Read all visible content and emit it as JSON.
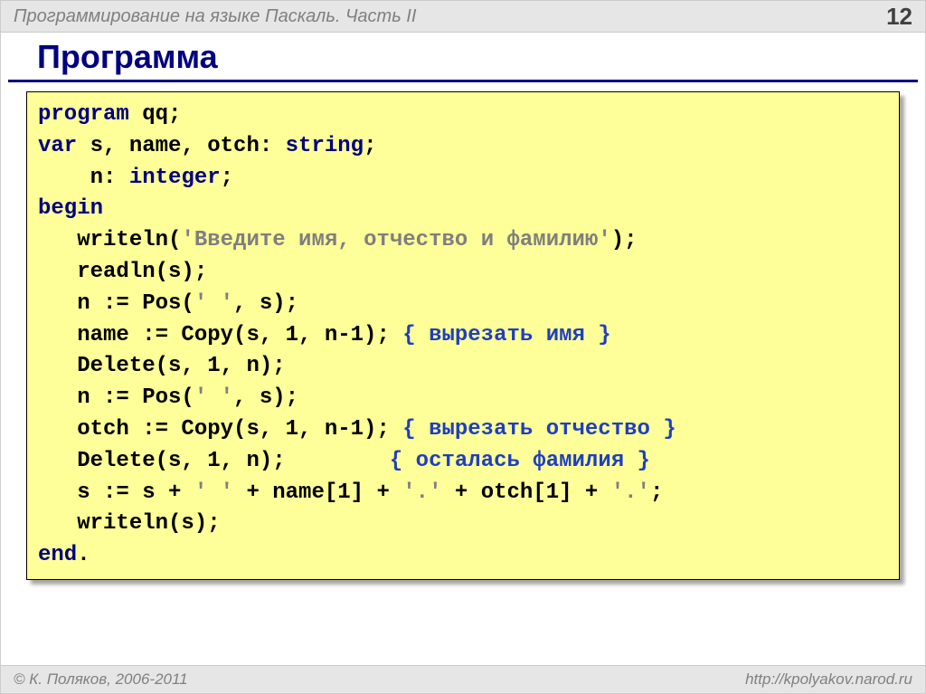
{
  "header": {
    "title": "Программирование на языке Паскаль. Часть II",
    "page": "12"
  },
  "title": "Программа",
  "code": {
    "l1": {
      "kw": "program",
      "rest": " qq;"
    },
    "l2": {
      "kw": "var",
      "rest": " s, name, otch: ",
      "type": "string",
      "end": ";"
    },
    "l3": {
      "pad": "    n: ",
      "type": "integer",
      "end": ";"
    },
    "l4": {
      "kw": "begin"
    },
    "l5": {
      "pad": "   writeln(",
      "str": "'Введите имя, отчество и фамилию'",
      "end": ");"
    },
    "l6": {
      "pad": "   readln(s);"
    },
    "l7": {
      "pad": "   n := Pos(",
      "str": "' '",
      "end": ", s);"
    },
    "l8": {
      "pad": "   name := Copy(s, 1, n-1); ",
      "cm": "{ вырезать имя }"
    },
    "l9": {
      "pad": "   Delete(s, 1, n);"
    },
    "l10": {
      "pad": "   n := Pos(",
      "str": "' '",
      "end": ", s);"
    },
    "l11": {
      "pad": "   otch := Copy(s, 1, n-1); ",
      "cm": "{ вырезать отчество }"
    },
    "l12": {
      "pad": "   Delete(s, 1, n);        ",
      "cm": "{ осталась фамилия }"
    },
    "l13": {
      "pad": "   s := s + ",
      "str1": "' '",
      "mid1": " + name[1] + ",
      "str2": "'.'",
      "mid2": " + otch[1] + ",
      "str3": "'.'",
      "end": ";"
    },
    "l14": {
      "pad": "   writeln(s);"
    },
    "l15": {
      "kw": "end",
      "end": "."
    }
  },
  "footer": {
    "copyright": "© К. Поляков, 2006-2011",
    "url": "http://kpolyakov.narod.ru"
  }
}
